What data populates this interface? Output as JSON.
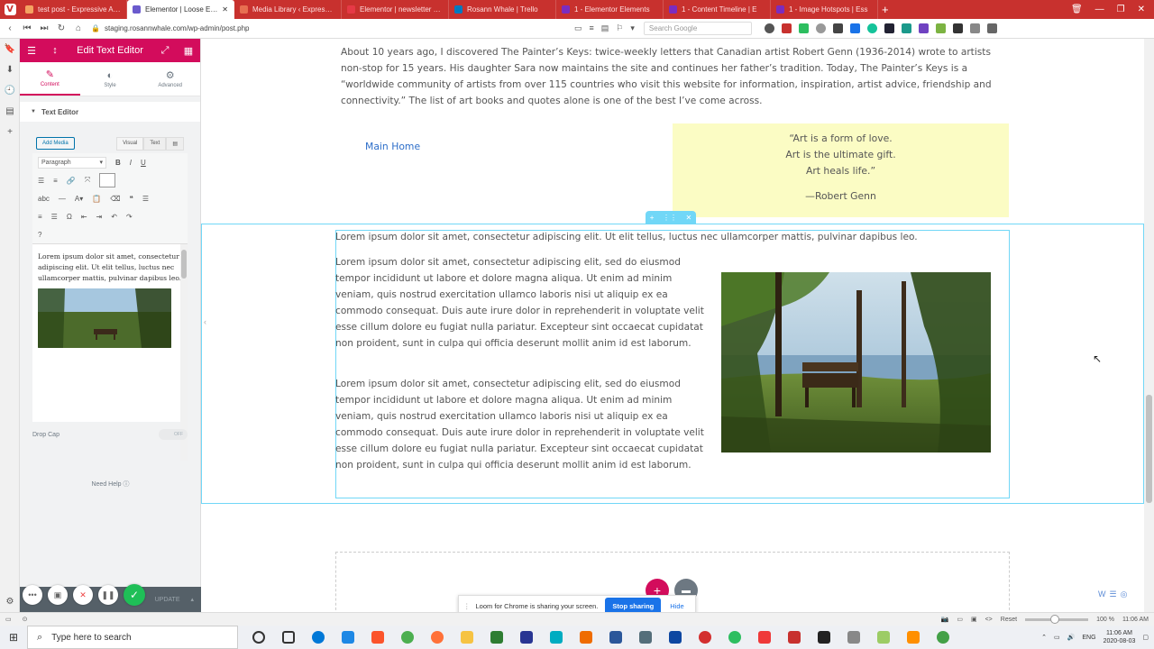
{
  "browser": {
    "tabs": [
      {
        "title": "test post - Expressive Arts",
        "color": "#f4a261",
        "active": false
      },
      {
        "title": "Elementor | Loose Ends",
        "color": "#6a5acd",
        "active": true
      },
      {
        "title": "Media Library ‹ Expressive",
        "color": "#e76f51",
        "active": false
      },
      {
        "title": "Elementor | newsletter sign",
        "color": "#e63946",
        "active": false
      },
      {
        "title": "Rosann Whale | Trello",
        "color": "#0079bf",
        "active": false
      },
      {
        "title": "1 - Elementor Elements",
        "color": "#7b2cbf",
        "active": false
      },
      {
        "title": "1 - Content Timeline | E",
        "color": "#7b2cbf",
        "active": false
      },
      {
        "title": "1 - Image Hotspots | Ess",
        "color": "#7b2cbf",
        "active": false
      }
    ],
    "url": "staging.rosannwhale.com/wp-admin/post.php",
    "search_placeholder": "Search Google",
    "badge_count": "22"
  },
  "elementor": {
    "header_title": "Edit Text Editor",
    "tabs": [
      {
        "label": "Content",
        "icon": "pencil-icon"
      },
      {
        "label": "Style",
        "icon": "contrast-icon"
      },
      {
        "label": "Advanced",
        "icon": "gear-icon"
      }
    ],
    "section_title": "Text Editor",
    "add_media": "Add Media",
    "visual_tab": "Visual",
    "text_tab": "Text",
    "format_select": "Paragraph",
    "editor_text": "Lorem ipsum dolor sit amet, consectetur adipiscing elit. Ut elit tellus, luctus nec ullamcorper mattis, pulvinar dapibus leo.",
    "drop_cap_label": "Drop Cap",
    "drop_cap_toggle": "OFF",
    "need_help": "Need Help",
    "update_button": "UPDATE"
  },
  "canvas": {
    "intro_text": "About 10 years ago, I discovered The Painter’s Keys: twice-weekly letters that Canadian artist Robert Genn (1936-2014) wrote to artists non-stop for 15 years. His daughter Sara now maintains the site and continues her father’s tradition. Today, The Painter’s Keys is a “worldwide community of artists from over 115 countries who visit this website for information, inspiration, artist advice, friendship and connectivity.” The list of art books and quotes alone is one of the best I’ve come across.",
    "main_home_link": "Main Home",
    "quote_lines": [
      "“Art is a form of love.",
      "Art is the ultimate gift.",
      "Art heals life.”"
    ],
    "quote_author": "—Robert Genn",
    "para1": "Lorem ipsum dolor sit amet, consectetur adipiscing elit. Ut elit tellus, luctus nec ullamcorper mattis, pulvinar dapibus leo.",
    "para2": "Lorem ipsum dolor sit amet, consectetur adipiscing elit, sed do eiusmod tempor incididunt ut labore et dolore magna aliqua. Ut enim ad minim veniam, quis nostrud exercitation ullamco laboris nisi ut aliquip ex ea commodo consequat. Duis aute irure dolor in reprehenderit in voluptate velit esse cillum dolore eu fugiat nulla pariatur. Excepteur sint occaecat cupidatat non proident, sunt in culpa qui officia deserunt mollit anim id est laborum.",
    "para3": "Lorem ipsum dolor sit amet, consectetur adipiscing elit, sed do eiusmod tempor incididunt ut labore et dolore magna aliqua. Ut enim ad minim veniam, quis nostrud exercitation ullamco laboris nisi ut aliquip ex ea commodo consequat. Duis aute irure dolor in reprehenderit in voluptate velit esse cillum dolore eu fugiat nulla pariatur. Excepteur sint occaecat cupidatat non proident, sunt in culpa qui officia deserunt mollit anim id est laborum."
  },
  "loom": {
    "message": "Loom for Chrome is sharing your screen.",
    "stop_button": "Stop sharing",
    "hide_button": "Hide"
  },
  "statusbar": {
    "reset": "Reset",
    "zoom": "100 %",
    "time": "11:06 AM"
  },
  "taskbar": {
    "search_placeholder": "Type here to search",
    "language": "ENG",
    "clock_time": "11:06 AM",
    "clock_date": "2020-08-03"
  },
  "colors": {
    "elementor_accent": "#d30c5c",
    "browser_red": "#c8312e",
    "selection_blue": "#71d7f7",
    "link_blue": "#2d6ec9",
    "quote_bg": "#fbfcc4"
  }
}
